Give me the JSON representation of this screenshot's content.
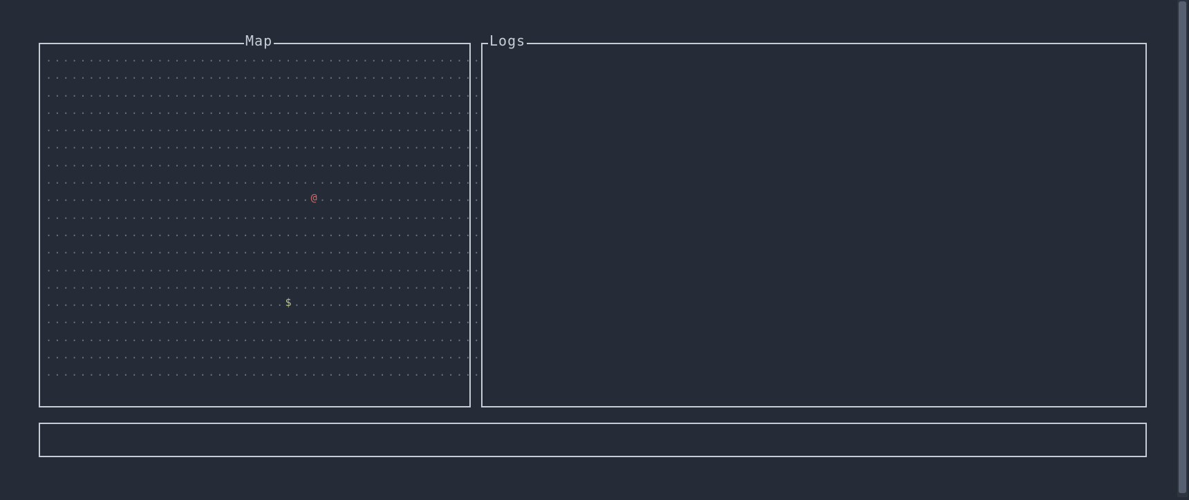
{
  "panels": {
    "map": {
      "title": "Map"
    },
    "logs": {
      "title": "Logs",
      "content": ""
    },
    "status": {
      "content": ""
    }
  },
  "map": {
    "cols": 55,
    "rows": 19,
    "floor_glyph": ".",
    "entities": [
      {
        "glyph": "@",
        "kind": "player",
        "col": 31,
        "row": 8
      },
      {
        "glyph": "$",
        "kind": "item",
        "col": 28,
        "row": 14
      }
    ]
  },
  "colors": {
    "bg": "#262c37",
    "border": "#c8cdd5",
    "floor": "#6b7380",
    "player": "#d06a6a",
    "item": "#b7c28a"
  }
}
